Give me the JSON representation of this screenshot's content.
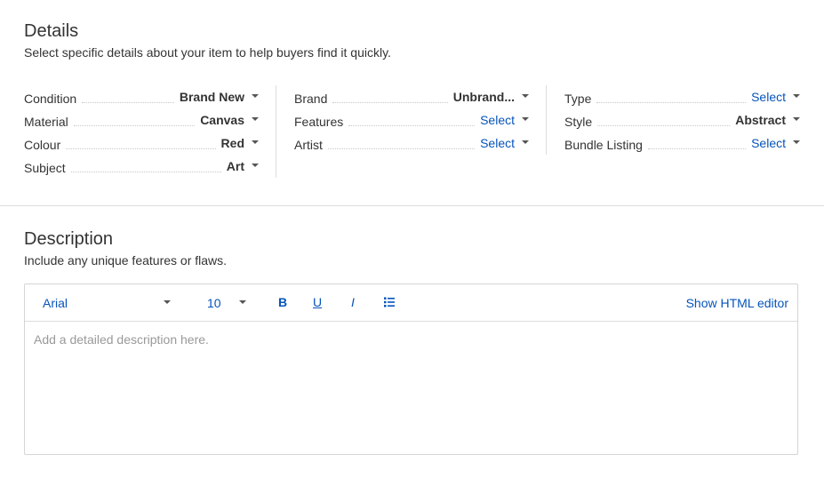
{
  "details": {
    "title": "Details",
    "subtitle": "Select specific details about your item to help buyers find it quickly.",
    "columns": [
      [
        {
          "label": "Condition",
          "value": "Brand New",
          "selected": true
        },
        {
          "label": "Material",
          "value": "Canvas",
          "selected": true
        },
        {
          "label": "Colour",
          "value": "Red",
          "selected": true
        },
        {
          "label": "Subject",
          "value": "Art",
          "selected": true
        }
      ],
      [
        {
          "label": "Brand",
          "value": "Unbrand...",
          "selected": true
        },
        {
          "label": "Features",
          "value": "Select",
          "selected": false
        },
        {
          "label": "Artist",
          "value": "Select",
          "selected": false
        }
      ],
      [
        {
          "label": "Type",
          "value": "Select",
          "selected": false
        },
        {
          "label": "Style",
          "value": "Abstract",
          "selected": true
        },
        {
          "label": "Bundle Listing",
          "value": "Select",
          "selected": false
        }
      ]
    ]
  },
  "description": {
    "title": "Description",
    "subtitle": "Include any unique features or flaws.",
    "toolbar": {
      "font": "Arial",
      "size": "10",
      "bold_label": "B",
      "underline_label": "U",
      "italic_label": "I",
      "list_icon": "bulleted-list-icon",
      "html_editor_label": "Show HTML editor"
    },
    "placeholder": "Add a detailed description here."
  },
  "colors": {
    "link": "#0654ba",
    "text": "#333333",
    "placeholder": "#999999",
    "divider": "#dddddd"
  }
}
